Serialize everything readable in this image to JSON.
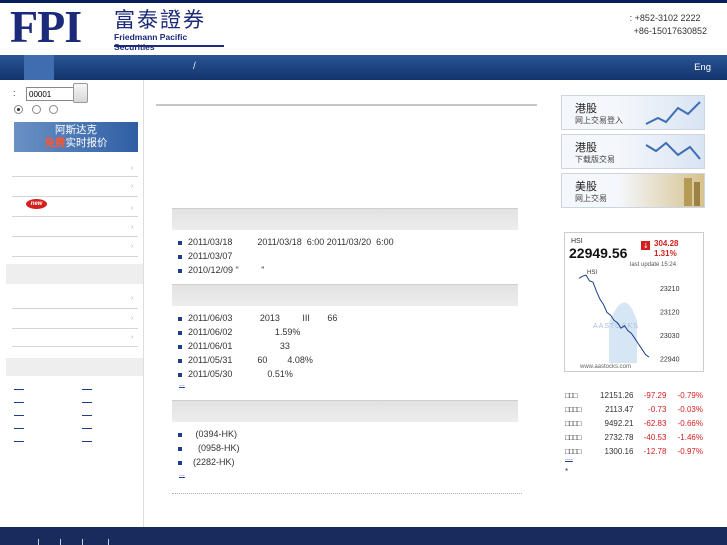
{
  "header": {
    "logo_letters": "FPI",
    "logo_chinese": "富泰證券",
    "logo_english": "Friedmann Pacific Securities",
    "phone_hk": ": +852-3102 2222",
    "phone_cn": "+86-15017630852"
  },
  "nav": {
    "separator": "/",
    "english_link": "Eng"
  },
  "quote_search": {
    "prefix": ":",
    "value": "00001"
  },
  "promo_banner": {
    "line1": "阿斯达克",
    "line2_red": "免费",
    "line2_rest": "实时报价"
  },
  "new_badge": "new",
  "news": {
    "items": [
      "2011/03/18          2011/03/18  6:00 2011/03/20  6:00",
      "2011/03/07",
      "2010/12/09 \"         \""
    ]
  },
  "research": {
    "items": [
      "2011/06/03           2013         III       66",
      "2011/06/02                 1.59%",
      "2011/06/01                   33",
      "2011/05/31          60        4.08%",
      "2011/05/30              0.51%"
    ],
    "more": "..."
  },
  "stocks": {
    "items": [
      "   (0394-HK)",
      "    (0958-HK)",
      "  (2282-HK)"
    ],
    "more": "..."
  },
  "right_banners": [
    {
      "title": "港股",
      "subtitle": "网上交易登入"
    },
    {
      "title": "港股",
      "subtitle": "下载版交易"
    },
    {
      "title": "美股",
      "subtitle": "网上交易"
    }
  ],
  "hsi_widget": {
    "label": "HSI",
    "value": "22949.56",
    "change": "304.28",
    "change_pct": "1.31%",
    "last_update": "last update 15:24",
    "chart_label": "HSI",
    "watermark": "AASTOCKS",
    "site": "www.aastocks.com",
    "y_ticks": [
      "23210",
      "23120",
      "23030",
      "22940"
    ],
    "down_color": "#d41e1e"
  },
  "chart_data": {
    "type": "line",
    "title": "",
    "series": [
      {
        "name": "HSI",
        "values": [
          23250,
          23258,
          23262,
          23240,
          23235,
          23200,
          23170,
          23150,
          23120,
          23110,
          23090,
          23080,
          23060,
          23070,
          23050,
          23040,
          23020,
          23000,
          22980,
          22960,
          22950
        ]
      }
    ],
    "y_ticks": [
      23210,
      23120,
      23030,
      22940
    ],
    "ylim": [
      22920,
      23270
    ],
    "grid": false
  },
  "indices": [
    {
      "name": "□□□",
      "value": "12151.26",
      "change": "-97.29",
      "pct": "-0.79%"
    },
    {
      "name": "□□□□",
      "value": "2113.47",
      "change": "-0.73",
      "pct": "-0.03%"
    },
    {
      "name": "□□□□",
      "value": "9492.21",
      "change": "-62.83",
      "pct": "-0.66%"
    },
    {
      "name": "□□□□",
      "value": "2732.78",
      "change": "-40.53",
      "pct": "-1.46%"
    },
    {
      "name": "□□□□",
      "value": "1300.16",
      "change": "-12.78",
      "pct": "-0.97%"
    }
  ],
  "indices_more": "....",
  "indices_note": "*"
}
